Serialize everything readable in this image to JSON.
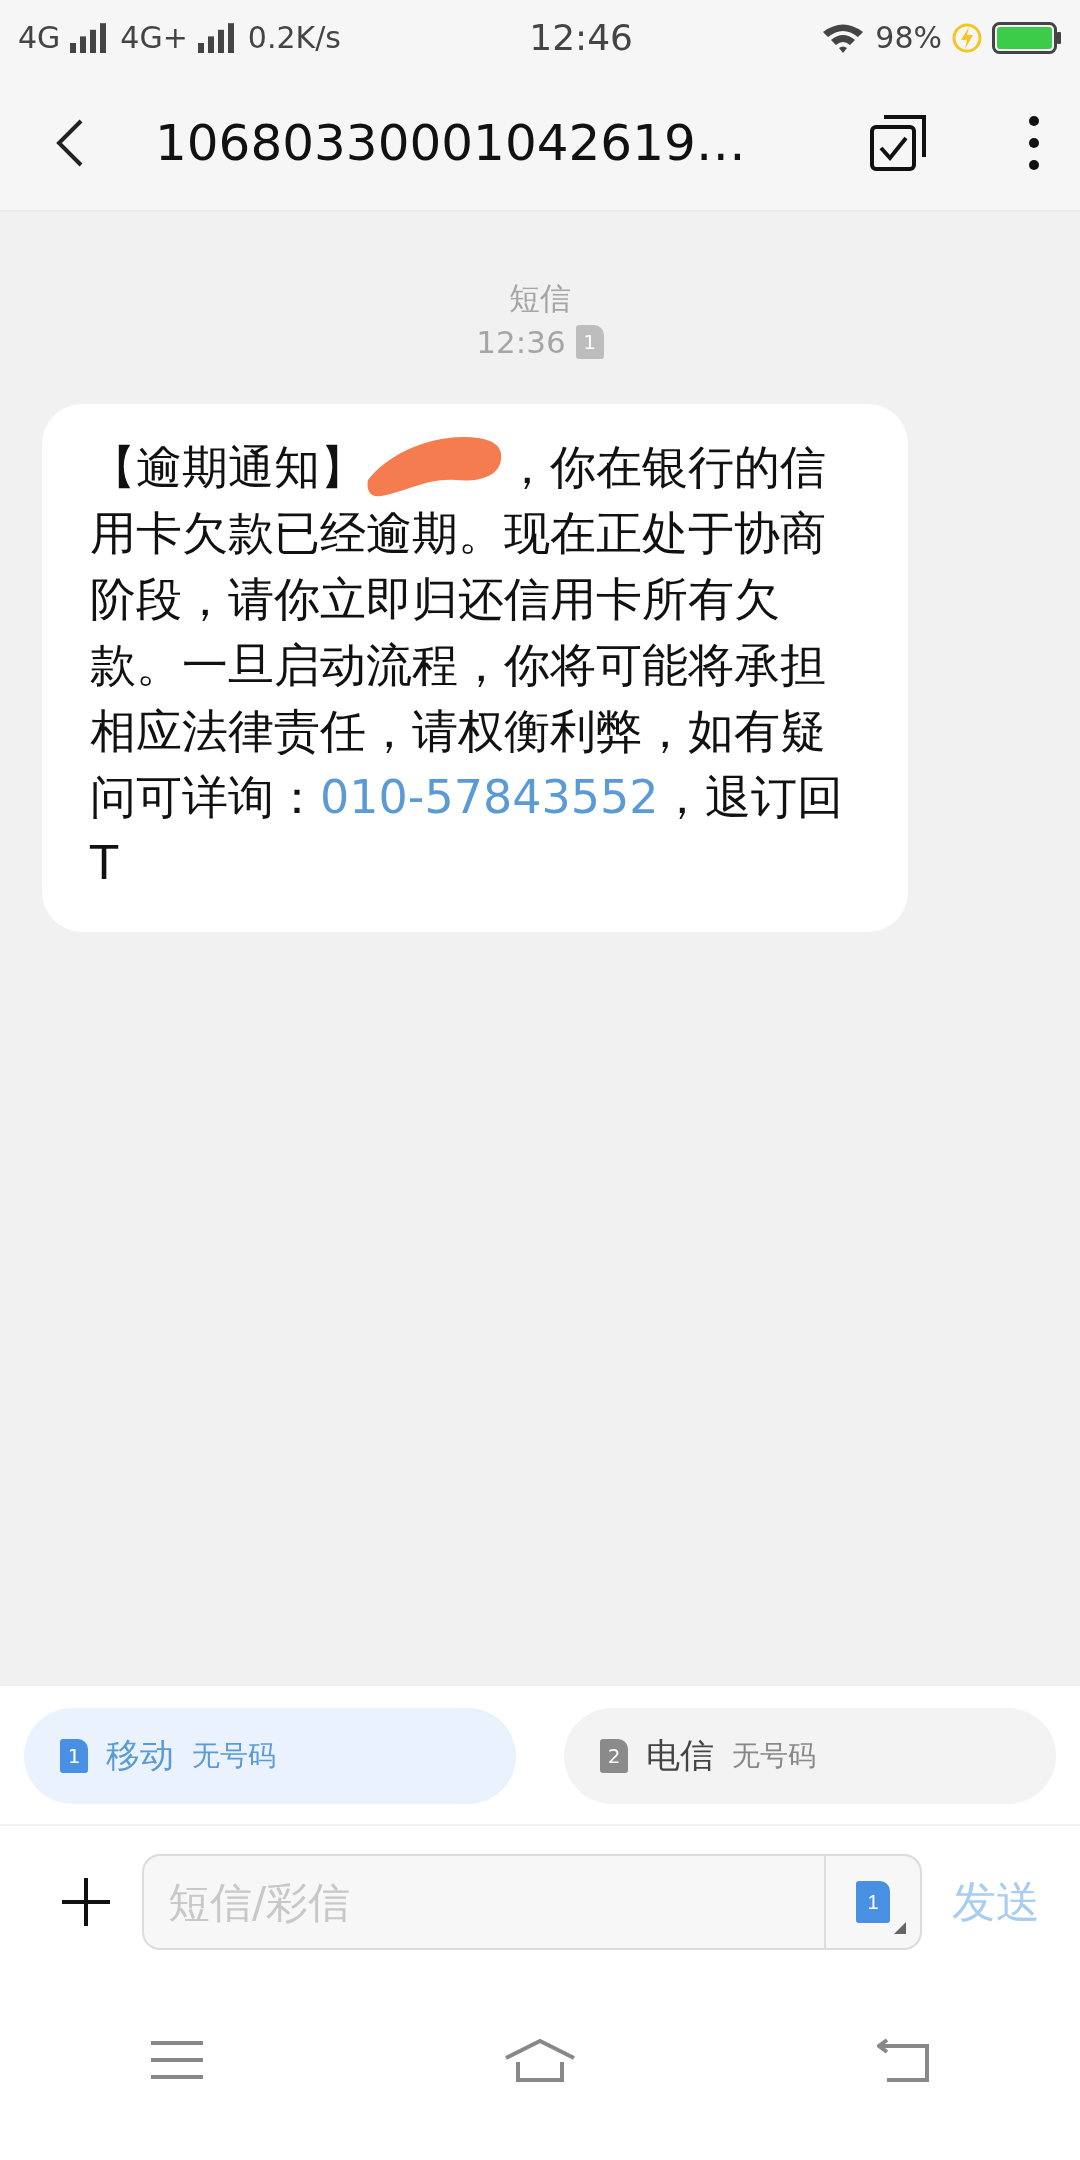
{
  "status_bar": {
    "network_1": "4G",
    "network_2": "4G+",
    "speed": "0.2K/s",
    "time": "12:46",
    "battery": "98%"
  },
  "header": {
    "title": "10680330001042619…"
  },
  "message_meta": {
    "type": "短信",
    "time": "12:36",
    "sim": "1"
  },
  "message": {
    "before": "【逾期通知】",
    "after": "，你在银行的信用卡欠款已经逾期。现在正处于协商阶段，请你立即归还信用卡所有欠款。一旦启动流程，你将可能将承担相应法律责任，请权衡利弊，如有疑问可详询：",
    "phone": "010-57843552",
    "tail": "，退订回T"
  },
  "sims": [
    {
      "index": "1",
      "carrier": "移动",
      "number": "无号码",
      "selected": true
    },
    {
      "index": "2",
      "carrier": "电信",
      "number": "无号码",
      "selected": false
    }
  ],
  "composer": {
    "placeholder": "短信/彩信",
    "sim": "1",
    "send": "发送"
  }
}
